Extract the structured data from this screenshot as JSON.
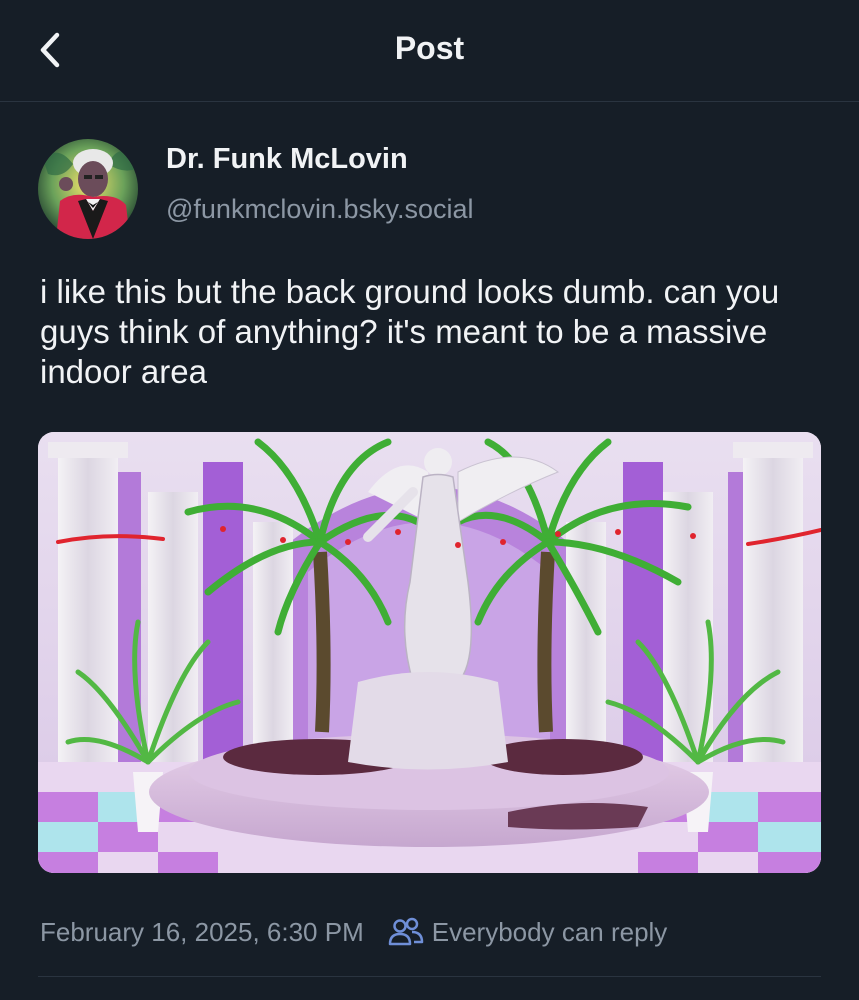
{
  "header": {
    "title": "Post",
    "back_icon": "chevron-left-icon"
  },
  "author": {
    "display_name": "Dr. Funk McLovin",
    "handle": "@funkmclovin.bsky.social"
  },
  "post": {
    "text": "i like this but the back ground looks dumb. can you guys think of anything? it's meant to be a massive indoor area"
  },
  "meta": {
    "timestamp": "February 16, 2025, 6:30 PM",
    "reply_setting_icon": "people-icon",
    "reply_setting": "Everybody can reply"
  },
  "colors": {
    "background": "#161e27",
    "text_primary": "#f1f3f5",
    "text_secondary": "#8c97a4",
    "reply_icon": "#6f8fd8",
    "divider": "#2a3440"
  }
}
